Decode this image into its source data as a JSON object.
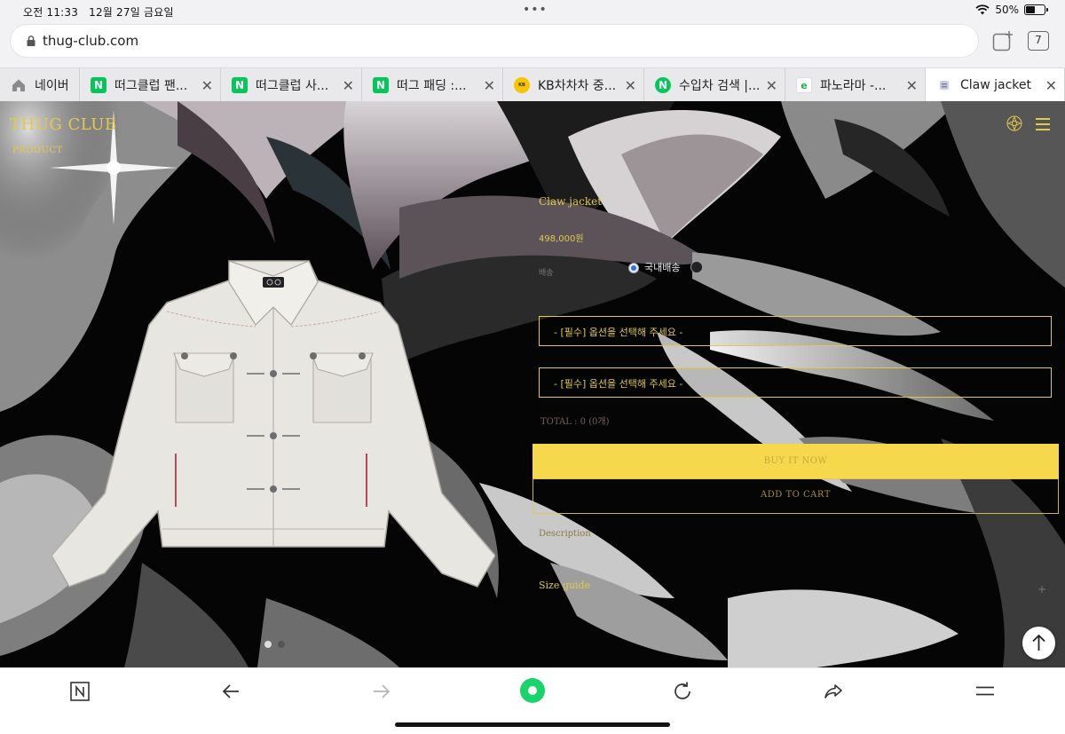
{
  "status": {
    "time": "오전 11:33",
    "date": "12월 27일 금요일",
    "battery": "50%",
    "battery_level": 0.5
  },
  "address": {
    "url": "thug-club.com",
    "tab_count": "7"
  },
  "tabs": [
    {
      "label": "네이버",
      "icon": "home-icon",
      "color": "#8a8a8a"
    },
    {
      "label": "떠그클럽 팬...",
      "icon": "naver-icon",
      "color": "#03c75a"
    },
    {
      "label": "떠그클럽 사...",
      "icon": "naver-icon",
      "color": "#03c75a"
    },
    {
      "label": "떠그 패딩 :...",
      "icon": "naver-icon",
      "color": "#03c75a"
    },
    {
      "label": "KB차차차 중...",
      "icon": "kb-icon",
      "color": "#f6c500"
    },
    {
      "label": "수입차 검색 |...",
      "icon": "naver-icon",
      "color": "#03c75a"
    },
    {
      "label": "파노라마 -...",
      "icon": "panorama-icon",
      "color": "#19b34a"
    },
    {
      "label": "Claw jacket",
      "icon": "page-icon",
      "color": "#7a7fa6"
    }
  ],
  "site": {
    "logo": "THUG CLUB",
    "nav_product": "PRODUCT"
  },
  "product": {
    "name": "Claw jacket",
    "price": "498,000원",
    "shipping_label": "배송",
    "shipping_option": "국내배송",
    "select1": "- [필수] 옵션을 선택해 주세요 -",
    "select2": "- [필수] 옵션을 선택해 주세요 -",
    "total": "TOTAL : 0 (0개)",
    "buy_now": "BUY IT NOW",
    "add_to_cart": "ADD TO CART",
    "description": "Description",
    "size_guide": "Size guide",
    "plus": "+"
  },
  "colors": {
    "accent": "#e2c94a",
    "buy_button": "#f5d84b"
  }
}
